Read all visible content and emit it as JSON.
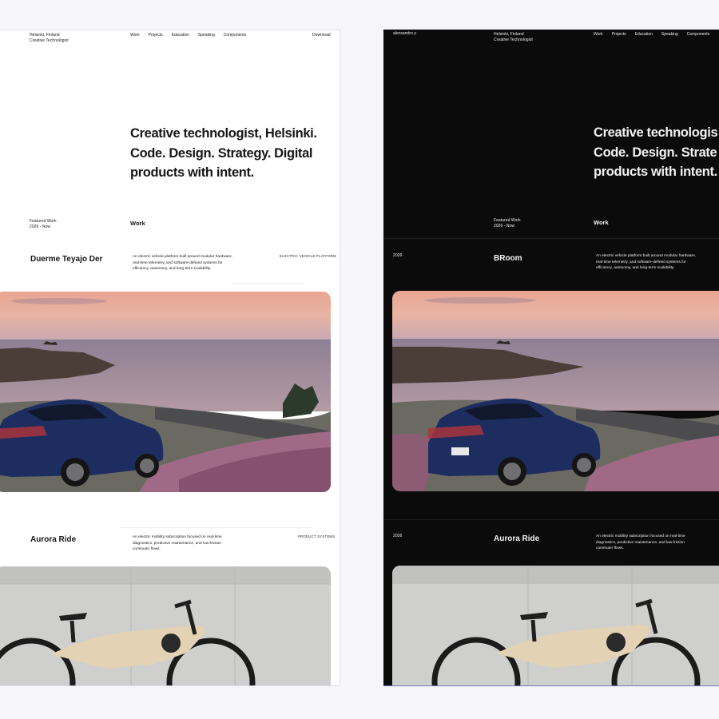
{
  "light": {
    "header": {
      "location": "Helsinki, Finland",
      "role": "Creative Technologist",
      "nav": [
        "Work",
        "Projects",
        "Education",
        "Speaking",
        "Components"
      ],
      "download": "Download"
    },
    "hero": {
      "line1": "Creative technologist, Helsinki.",
      "line2": "Code. Design. Strategy. Digital",
      "line3": "products with intent."
    },
    "featured": {
      "label": "Featured Work",
      "years": "2026 - Now",
      "section": "Work"
    },
    "projects": [
      {
        "name": "Duerme Teyajo Der",
        "desc": "An electric vehicle platform built around modular hardware, real-time telemetry, and software-defined systems for efficiency, autonomy, and long-term scalability.",
        "category": "ELECTRIC VEHICLE PLATFORM"
      },
      {
        "name": "Aurora Ride",
        "desc": "An electric mobility subscription focused on real-time diagnostics, predictive maintenance, and low-friction commuter flows.",
        "category": "PRODUCT SYSTEMS"
      }
    ]
  },
  "dark": {
    "header": {
      "handle": "alexsandro.y",
      "location": "Helsinki, Finland",
      "role": "Creative Technologist",
      "nav": [
        "Work",
        "Projects",
        "Education",
        "Speaking",
        "Components"
      ]
    },
    "hero": {
      "line1": "Creative technologis",
      "line2": "Code. Design. Strate",
      "line3": "products with intent."
    },
    "featured": {
      "label": "Featured Work",
      "years": "2026 - Now",
      "section": "Work"
    },
    "projects": [
      {
        "year": "2026",
        "name": "BRoom",
        "desc": "An electric vehicle platform built around modular hardware, real-time telemetry, and software-defined systems for efficiency, autonomy, and long-term scalability."
      },
      {
        "year": "2026",
        "name": "Aurora Ride",
        "desc": "An electric mobility subscription focused on real-time diagnostics, predictive maintenance, and low-friction commuter flows."
      }
    ]
  },
  "colors": {
    "light_bg": "#ffffff",
    "dark_bg": "#0b0b0b",
    "page_bg": "#f6f6f8"
  }
}
